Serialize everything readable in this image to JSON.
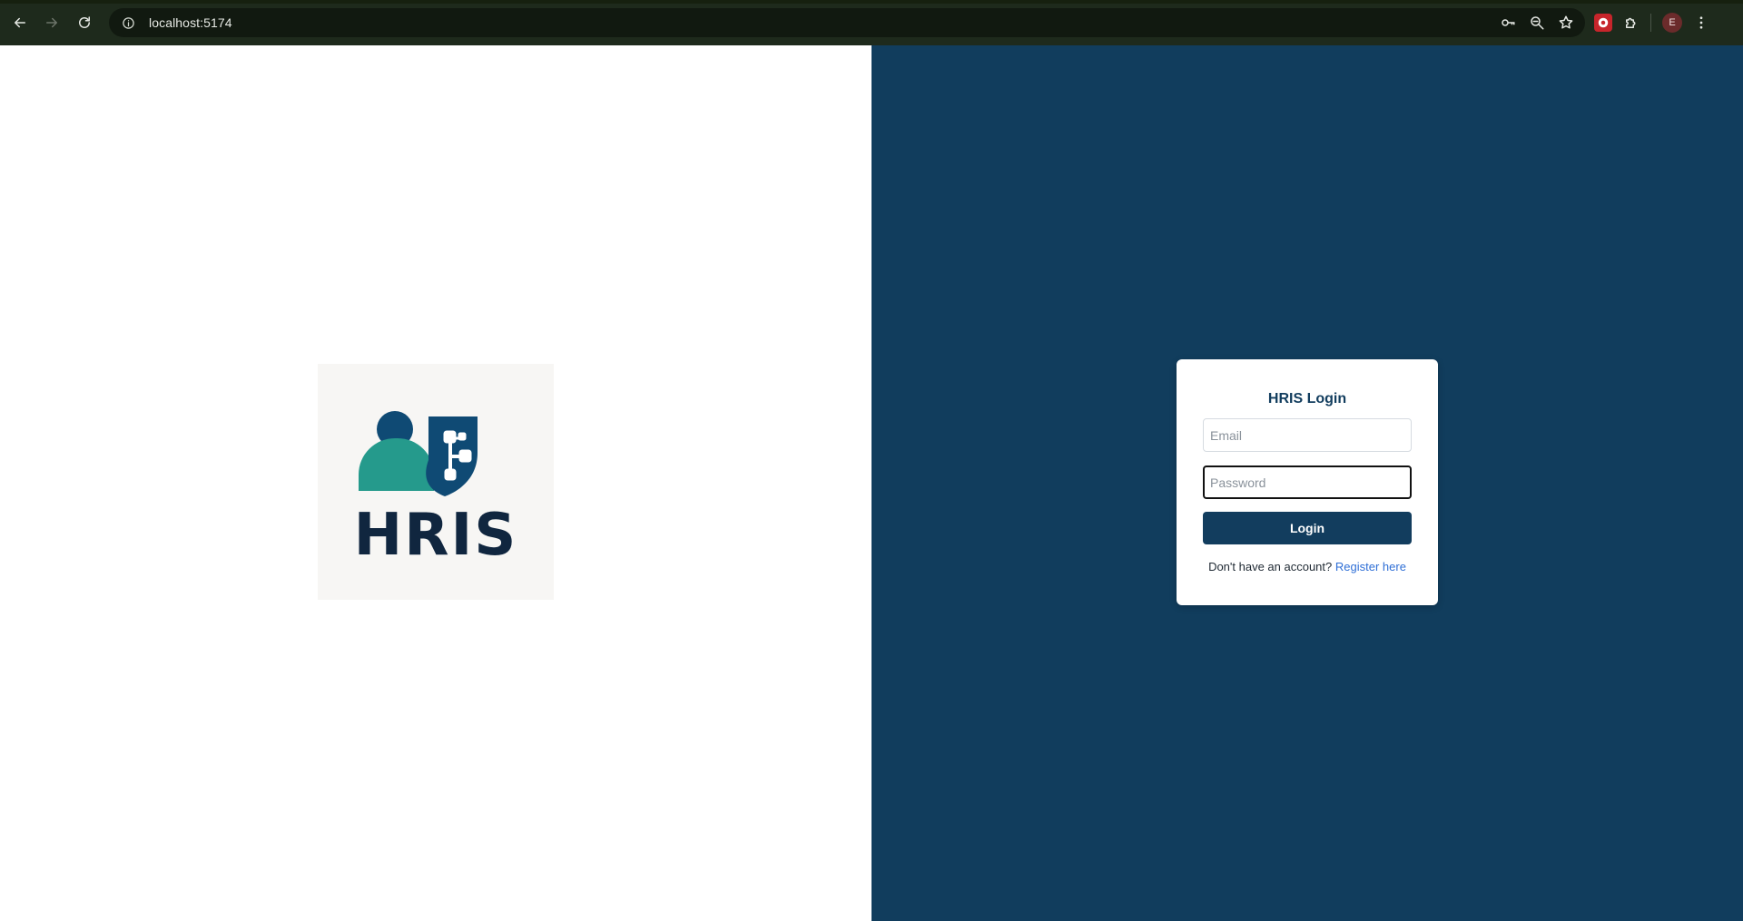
{
  "browser": {
    "url": "localhost:5174",
    "profile_initial": "E",
    "icons": {
      "back": "arrow-left-icon",
      "forward": "arrow-right-icon",
      "reload": "reload-icon",
      "site_info": "info-icon",
      "password": "key-icon",
      "zoom": "zoom-out-icon",
      "bookmark": "star-icon",
      "extension": "extension-icon",
      "extensions_menu": "puzzle-icon",
      "menu": "more-vertical-icon"
    }
  },
  "brand": {
    "logo_text": "HRIS",
    "colors": {
      "navy": "#0f3a5c",
      "teal": "#259a8c",
      "dark": "#10263f"
    }
  },
  "login": {
    "title": "HRIS Login",
    "email_placeholder": "Email",
    "email_value": "",
    "password_placeholder": "Password",
    "password_value": "",
    "submit_label": "Login",
    "register_prompt": "Don't have an account?",
    "register_link": "Register here"
  },
  "colors": {
    "right_panel_bg": "#113d5d",
    "button_bg": "#123d5e",
    "link": "#2f6fd6"
  }
}
